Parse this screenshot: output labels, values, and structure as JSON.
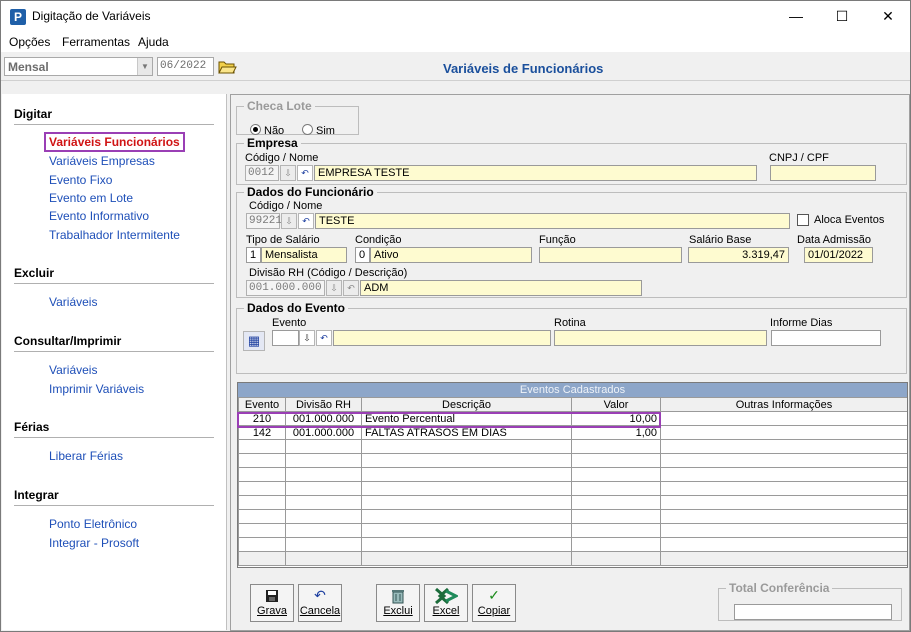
{
  "window": {
    "title": "Digitação de Variáveis",
    "app_icon": "P",
    "minimize": "—",
    "maximize": "☐",
    "close": "✕"
  },
  "menu": [
    {
      "label": "Opções"
    },
    {
      "label": "Ferramentas"
    },
    {
      "label": "Ajuda"
    }
  ],
  "toolbar": {
    "period_value": "Mensal",
    "date_value": "06/2022"
  },
  "page_title": "Variáveis de Funcionários",
  "sidebar": {
    "sections": [
      {
        "title": "Digitar",
        "items": [
          "Variáveis Funcionários",
          "Variáveis Empresas",
          "Evento Fixo",
          "Evento em Lote",
          "Evento Informativo",
          "Trabalhador Intermitente"
        ]
      },
      {
        "title": "Excluir",
        "items": [
          "Variáveis"
        ]
      },
      {
        "title": "Consultar/Imprimir",
        "items": [
          "Variáveis",
          "Imprimir Variáveis"
        ]
      },
      {
        "title": "Férias",
        "items": [
          "Liberar Férias"
        ]
      },
      {
        "title": "Integrar",
        "items": [
          "Ponto Eletrônico",
          "Integrar - Prosoft"
        ]
      }
    ]
  },
  "checa_lote": {
    "legend": "Checa Lote",
    "opt_no": "Não",
    "opt_yes": "Sim",
    "selected": "Não"
  },
  "empresa": {
    "legend": "Empresa",
    "codigo_label": "Código / Nome",
    "codigo": "0012",
    "nome": "EMPRESA TESTE",
    "cnpj_label": "CNPJ / CPF",
    "cnpj": ""
  },
  "funcionario": {
    "legend": "Dados do Funcionário",
    "codigo_label": "Código / Nome",
    "codigo": "99221",
    "nome": "TESTE",
    "aloca_label": "Aloca Eventos",
    "tipo_label": "Tipo de Salário",
    "tipo_code": "1",
    "tipo_desc": "Mensalista",
    "condicao_label": "Condição",
    "condicao_code": "0",
    "condicao_desc": "Ativo",
    "funcao_label": "Função",
    "funcao": "",
    "salario_label": "Salário Base",
    "salario": "3.319,47",
    "admissao_label": "Data Admissão",
    "admissao": "01/01/2022",
    "divisao_label": "Divisão RH (Código / Descrição)",
    "divisao_code": "001.000.000",
    "divisao_desc": "ADM"
  },
  "evento": {
    "legend": "Dados do Evento",
    "evento_label": "Evento",
    "rotina_label": "Rotina",
    "dias_label": "Informe Dias"
  },
  "grid": {
    "title": "Eventos Cadastrados",
    "columns": [
      "Evento",
      "Divisão RH",
      "Descrição",
      "Valor",
      "Outras Informações"
    ],
    "rows": [
      [
        "210",
        "001.000.000",
        "Evento Percentual",
        "10,00",
        ""
      ],
      [
        "142",
        "001.000.000",
        "FALTAS ATRASOS EM DIAS",
        "1,00",
        ""
      ]
    ]
  },
  "buttons": {
    "grava": "Grava",
    "cancela": "Cancela",
    "exclui": "Exclui",
    "excel": "Excel",
    "copiar": "Copiar"
  },
  "total": {
    "legend": "Total Conferência",
    "value": ""
  }
}
